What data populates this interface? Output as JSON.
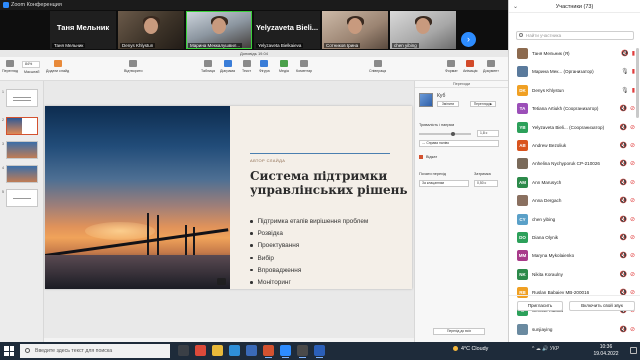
{
  "window": {
    "title": "Zoom Конференция"
  },
  "video_strip": {
    "tiles": [
      {
        "big_name": "Таня Мельник",
        "small_name": "Таня Мельник"
      },
      {
        "big_name": "",
        "small_name": "Denys Khlystun"
      },
      {
        "big_name": "",
        "small_name": "Марина Меккалушвил..."
      },
      {
        "big_name": "Yelyzaveta Bieli...",
        "small_name": "Yelyzaveta Bielkaieva"
      },
      {
        "big_name": "",
        "small_name": "Сотников Ірина"
      },
      {
        "big_name": "",
        "small_name": "chen yibing"
      }
    ],
    "next_label": "›"
  },
  "powerpoint": {
    "document_title": "Доповідь 19.04",
    "ribbon": [
      {
        "label": "Перегляд",
        "color": "gray"
      },
      {
        "label": "Масштаб",
        "color": "gray"
      },
      {
        "label": "Додати слайд",
        "color": "orange"
      },
      {
        "label": "Відтворити",
        "color": "gray"
      },
      {
        "label": "Таблиця",
        "color": "gray"
      },
      {
        "label": "Діаграма",
        "color": "blue"
      },
      {
        "label": "Текст",
        "color": "gray"
      },
      {
        "label": "Фігура",
        "color": "blue"
      },
      {
        "label": "Медіа",
        "color": "green"
      },
      {
        "label": "Коментар",
        "color": "gray"
      },
      {
        "label": "Співпраця",
        "color": "gray"
      },
      {
        "label": "Формат",
        "color": "gray"
      },
      {
        "label": "Анімація",
        "color": "gray"
      },
      {
        "label": "Документ",
        "color": "gray"
      }
    ],
    "zoom_value": "84%",
    "slide_numbers": [
      "1",
      "2",
      "3",
      "4",
      "5"
    ],
    "slide": {
      "kicker": "АВТОР СЛАЙДА",
      "title": "Система підтримки управлінських рішень",
      "bullets": [
        "Підтримка етапів вирішення проблем",
        "Розвідка",
        "Проектування",
        "Вибір",
        "Впровадження",
        "Моніторинг"
      ]
    },
    "pane": {
      "header": "Переходи",
      "effect_name": "Куб",
      "change_button": "Змінити",
      "preview_button": "Перегляд ▶",
      "duration_label": "Тривалість і напрям",
      "duration_value": "1,8 с",
      "direction_value": "↔ Справа наліво",
      "sound_label": "Відкат",
      "start_label": "Почати перехід",
      "delay_label": "Затримка",
      "start_value": "За клацанням",
      "delay_value": "0,50 с",
      "apply_button": "Перехід до всіх"
    }
  },
  "participants": {
    "title": "Участники (73)",
    "search_placeholder": "Найти участника",
    "list": [
      {
        "initials": "",
        "name": "Таня Мельник (Я)",
        "color": "#8c6a4f",
        "mic": "muted",
        "cam": "on"
      },
      {
        "initials": "",
        "name": "Марина Мек... (Организатор)",
        "color": "#5a7a9c",
        "mic": "on",
        "cam": "on"
      },
      {
        "initials": "DK",
        "name": "Denys Khlystun",
        "color": "#f0a023",
        "mic": "on",
        "cam": "on"
      },
      {
        "initials": "TA",
        "name": "Tetiana Artiukh (Соорганизатор)",
        "color": "#9b4fb8",
        "mic": "muted",
        "cam": "off"
      },
      {
        "initials": "YB",
        "name": "Yelyzaveta Bieli... (Соорганизатор)",
        "color": "#2ca05a",
        "mic": "muted",
        "cam": "off"
      },
      {
        "initials": "AB",
        "name": "Andrew Bezoliuk",
        "color": "#d9541e",
        "mic": "muted",
        "cam": "off"
      },
      {
        "initials": "",
        "name": "Anhelina Nychyporuk CP-210026",
        "color": "#7a6a5a",
        "mic": "muted",
        "cam": "off"
      },
      {
        "initials": "AM",
        "name": "Ann Marusych",
        "color": "#2c8a4a",
        "mic": "muted",
        "cam": "off"
      },
      {
        "initials": "",
        "name": "Anna Dergach",
        "color": "#8a7060",
        "mic": "muted",
        "cam": "off"
      },
      {
        "initials": "CY",
        "name": "chen yibing",
        "color": "#5aa0c8",
        "mic": "muted",
        "cam": "off"
      },
      {
        "initials": "DO",
        "name": "Diana Olynik",
        "color": "#2ca05a",
        "mic": "muted",
        "cam": "off"
      },
      {
        "initials": "MM",
        "name": "Maryna Mykolaienko",
        "color": "#a83a8a",
        "mic": "muted",
        "cam": "off"
      },
      {
        "initials": "NK",
        "name": "Nikita Koraulny",
        "color": "#2c8a4a",
        "mic": "muted",
        "cam": "off"
      },
      {
        "initials": "RB",
        "name": "Ruslan Babaiev MB-200016",
        "color": "#f0a023",
        "mic": "muted",
        "cam": "off"
      },
      {
        "initials": "S",
        "name": "Serova. masha",
        "color": "#2ca05a",
        "mic": "muted",
        "cam": "off"
      },
      {
        "initials": "",
        "name": "sunjiaying",
        "color": "#6a8aa0",
        "mic": "muted",
        "cam": "off"
      }
    ],
    "footer": {
      "invite": "Пригласить",
      "unmute": "Включить свой звук"
    }
  },
  "taskbar": {
    "search_placeholder": "Введите здесь текст для поиска",
    "apps": [
      {
        "name": "task-view-icon",
        "color": "#3a3f46"
      },
      {
        "name": "chrome-icon",
        "color": "#dc4a3a"
      },
      {
        "name": "file-explorer-icon",
        "color": "#e8b93a"
      },
      {
        "name": "edge-icon",
        "color": "#2f8fd8"
      },
      {
        "name": "store-icon",
        "color": "#3a6ab8"
      },
      {
        "name": "powerpoint-icon",
        "color": "#d35230"
      },
      {
        "name": "zoom-icon",
        "color": "#2d8cff"
      },
      {
        "name": "camera-icon",
        "color": "#4a4a4a"
      },
      {
        "name": "word-icon",
        "color": "#2b5fb8"
      }
    ],
    "weather": "4°C  Cloudy",
    "tray": "^  ☁  🔊  УКР",
    "time": "10:36",
    "date": "19.04.2022"
  }
}
